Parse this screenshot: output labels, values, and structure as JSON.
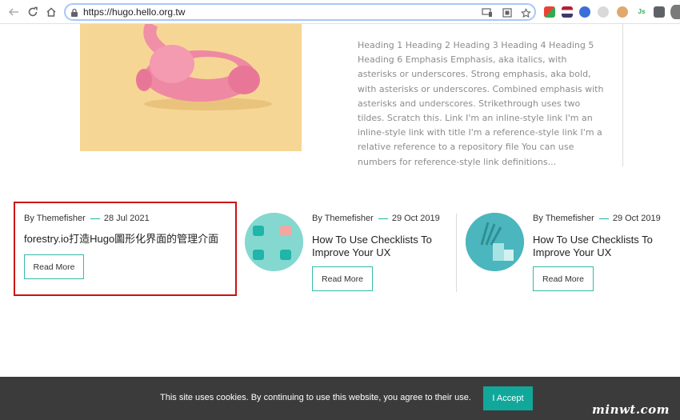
{
  "browser": {
    "url": "https://hugo.hello.org.tw"
  },
  "hero": {
    "excerpt": "Heading 1 Heading 2 Heading 3 Heading 4 Heading 5 Heading 6 Emphasis Emphasis, aka italics, with asterisks or underscores. Strong emphasis, aka bold, with asterisks or underscores. Combined emphasis with asterisks and underscores. Strikethrough uses two tildes. Scratch this. Link I'm an inline-style link I'm an inline-style link with title I'm a reference-style link I'm a relative reference to a repository file You can use numbers for reference-style link definitions..."
  },
  "posts": [
    {
      "author": "By Themefisher",
      "date": "28 Jul 2021",
      "title": "forestry.io打造Hugo圖形化界面的管理介面",
      "button": "Read More"
    },
    {
      "author": "By Themefisher",
      "date": "29 Oct 2019",
      "title": "How To Use Checklists To Improve Your UX",
      "button": "Read More"
    },
    {
      "author": "By Themefisher",
      "date": "29 Oct 2019",
      "title": "How To Use Checklists To Improve Your UX",
      "button": "Read More"
    }
  ],
  "cookie": {
    "text": "This site uses cookies. By continuing to use this website, you agree to their use.",
    "accept": "I Accept"
  },
  "watermark": "minwt.com",
  "colors": {
    "accent": "#1bb3a6",
    "highlight": "#cc1111",
    "cookie_bg": "#3b3b3b"
  }
}
